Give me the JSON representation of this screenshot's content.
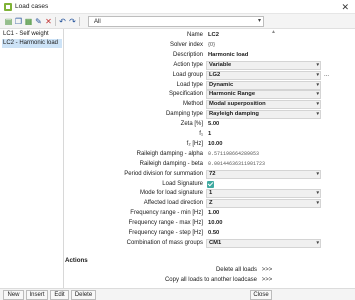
{
  "window": {
    "title": "Load cases",
    "close_glyph": "✕"
  },
  "toolbar": {
    "icons": [
      "new-icon",
      "copy-icon",
      "insert-icon",
      "edit-icon",
      "delete-icon",
      "undo-icon",
      "redo-icon",
      "table-icon",
      "save-icon",
      "print-icon"
    ],
    "filter_value": "All"
  },
  "list": {
    "items": [
      {
        "label": "LC1 - Self weight"
      },
      {
        "label": "LC2 - Harmonic load"
      }
    ],
    "selected_index": 1
  },
  "properties": [
    {
      "label": "Name",
      "value": "LC2",
      "kind": "text",
      "bold": true
    },
    {
      "label": "Solver index",
      "value": "{0}",
      "kind": "ro"
    },
    {
      "label": "Description",
      "value": "Harmonic load",
      "kind": "text",
      "bold": true
    },
    {
      "label": "Action type",
      "value": "Variable",
      "kind": "dropdown",
      "bold": true
    },
    {
      "label": "Load group",
      "value": "LG2",
      "kind": "dropdown",
      "bold": true,
      "ellipsis": "..."
    },
    {
      "label": "Load type",
      "value": "Dynamic",
      "kind": "dropdown",
      "bold": true
    },
    {
      "label": "Specification",
      "value": "Harmonic Range",
      "kind": "dropdown",
      "bold": true
    },
    {
      "label": "Method",
      "value": "Modal superposition",
      "kind": "dropdown",
      "bold": true
    },
    {
      "label": "Damping type",
      "value": "Rayleigh damping",
      "kind": "dropdown",
      "bold": true
    },
    {
      "label": "Zeta [%]",
      "value": "5.00",
      "kind": "text",
      "bold": true
    },
    {
      "label": "f₁",
      "value": "1",
      "kind": "text",
      "bold": true
    },
    {
      "label": "f₂ [Hz]",
      "value": "10.00",
      "kind": "text",
      "bold": true
    },
    {
      "label": "Raileigh damping - alpha",
      "value": "0.571198664289053",
      "kind": "mono"
    },
    {
      "label": "Raileigh damping - beta",
      "value": "0.00144636311901723",
      "kind": "mono"
    },
    {
      "label": "Period division for summation",
      "value": "72",
      "kind": "dropdown",
      "bold": true
    },
    {
      "label": "Load Signature",
      "value": "",
      "kind": "check"
    },
    {
      "label": "Mode for load signature",
      "value": "1",
      "kind": "dropdown",
      "bold": true
    },
    {
      "label": "Affected load direction",
      "value": "Z",
      "kind": "dropdown",
      "bold": true
    },
    {
      "label": "Frequency range - min [Hz]",
      "value": "1.00",
      "kind": "text",
      "bold": true
    },
    {
      "label": "Frequency range - max [Hz]",
      "value": "10.00",
      "kind": "text",
      "bold": true
    },
    {
      "label": "Frequency range - step [Hz]",
      "value": "0.50",
      "kind": "text",
      "bold": true
    },
    {
      "label": "Combination of mass groups",
      "value": "CM1",
      "kind": "dropdown",
      "bold": true
    }
  ],
  "actions": {
    "header": "Actions",
    "items": [
      {
        "label": "Delete all loads",
        "button": ">>>"
      },
      {
        "label": "Copy all loads to another loadcase",
        "button": ">>>"
      }
    ]
  },
  "bottom": {
    "new": "New",
    "insert": "Insert",
    "edit": "Edit",
    "delete": "Delete",
    "close": "Close"
  }
}
